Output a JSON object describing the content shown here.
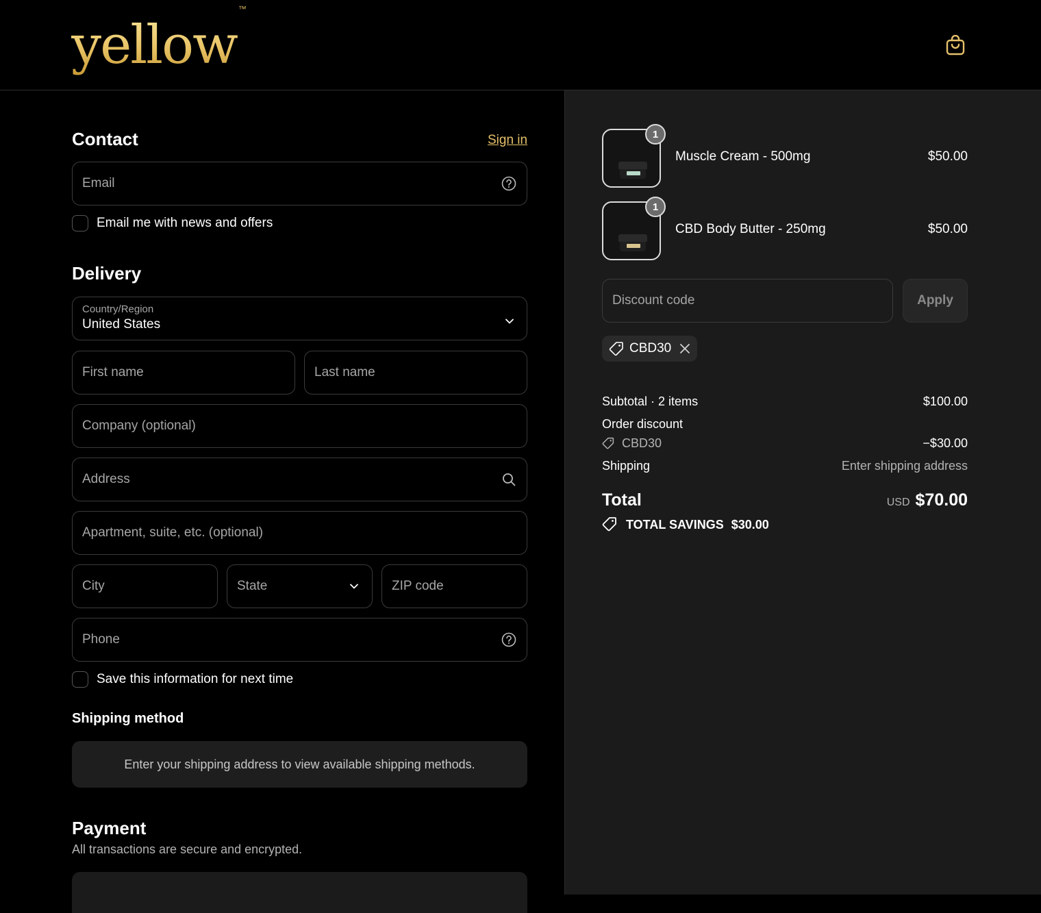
{
  "header": {
    "logo_text": "yellow",
    "logo_tm": "™",
    "cart_icon": "shopping-bag-icon"
  },
  "contact": {
    "title": "Contact",
    "sign_in": "Sign in",
    "email_placeholder": "Email",
    "email_help_icon": "help-circle-icon",
    "news_checkbox_label": "Email me with news and offers"
  },
  "delivery": {
    "title": "Delivery",
    "country_label": "Country/Region",
    "country_value": "United States",
    "first_name": "First name",
    "last_name": "Last name",
    "company": "Company (optional)",
    "address": "Address",
    "apartment": "Apartment, suite, etc. (optional)",
    "city": "City",
    "state": "State",
    "zip": "ZIP code",
    "phone": "Phone",
    "save_info_label": "Save this information for next time"
  },
  "shipping_method": {
    "title": "Shipping method",
    "notice": "Enter your shipping address to view available shipping methods."
  },
  "payment": {
    "title": "Payment",
    "subtitle": "All transactions are secure and encrypted."
  },
  "summary": {
    "items": [
      {
        "name": "Muscle Cream - 500mg",
        "price": "$50.00",
        "qty": "1"
      },
      {
        "name": "CBD Body Butter - 250mg",
        "price": "$50.00",
        "qty": "1"
      }
    ],
    "discount_placeholder": "Discount code",
    "apply_label": "Apply",
    "applied_code": "CBD30",
    "subtotal_label": "Subtotal · 2 items",
    "subtotal_value": "$100.00",
    "order_discount_label": "Order discount",
    "discount_code": "CBD30",
    "discount_value": "−$30.00",
    "shipping_label": "Shipping",
    "shipping_value": "Enter shipping address",
    "total_label": "Total",
    "currency": "USD",
    "total_value": "$70.00",
    "savings_label": "TOTAL SAVINGS",
    "savings_value": "$30.00"
  },
  "colors": {
    "accent": "#e5c16a",
    "background": "#000000",
    "summary_background": "#1b1b1b"
  }
}
